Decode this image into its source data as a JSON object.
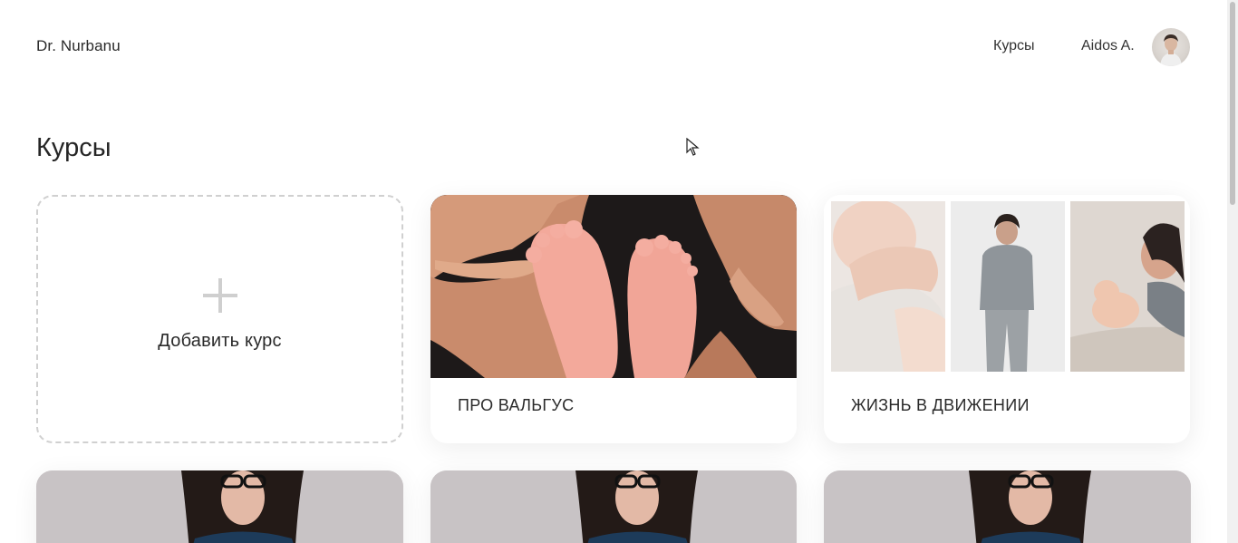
{
  "header": {
    "brand": "Dr. Nurbanu",
    "nav_courses": "Курсы",
    "user_name": "Aidos A."
  },
  "main": {
    "title": "Курсы",
    "add_course_label": "Добавить курс",
    "courses": [
      {
        "title": "ПРО ВАЛЬГУС"
      },
      {
        "title": "ЖИЗНЬ В ДВИЖЕНИИ"
      }
    ]
  },
  "icons": {
    "add": "plus-icon",
    "avatar": "avatar-photo",
    "cursor": "mouse-pointer"
  },
  "colors": {
    "background": "#ffffff",
    "text": "#2a2a2a",
    "dashed_border": "#d0d0d0",
    "plus": "#cfcfcf"
  }
}
